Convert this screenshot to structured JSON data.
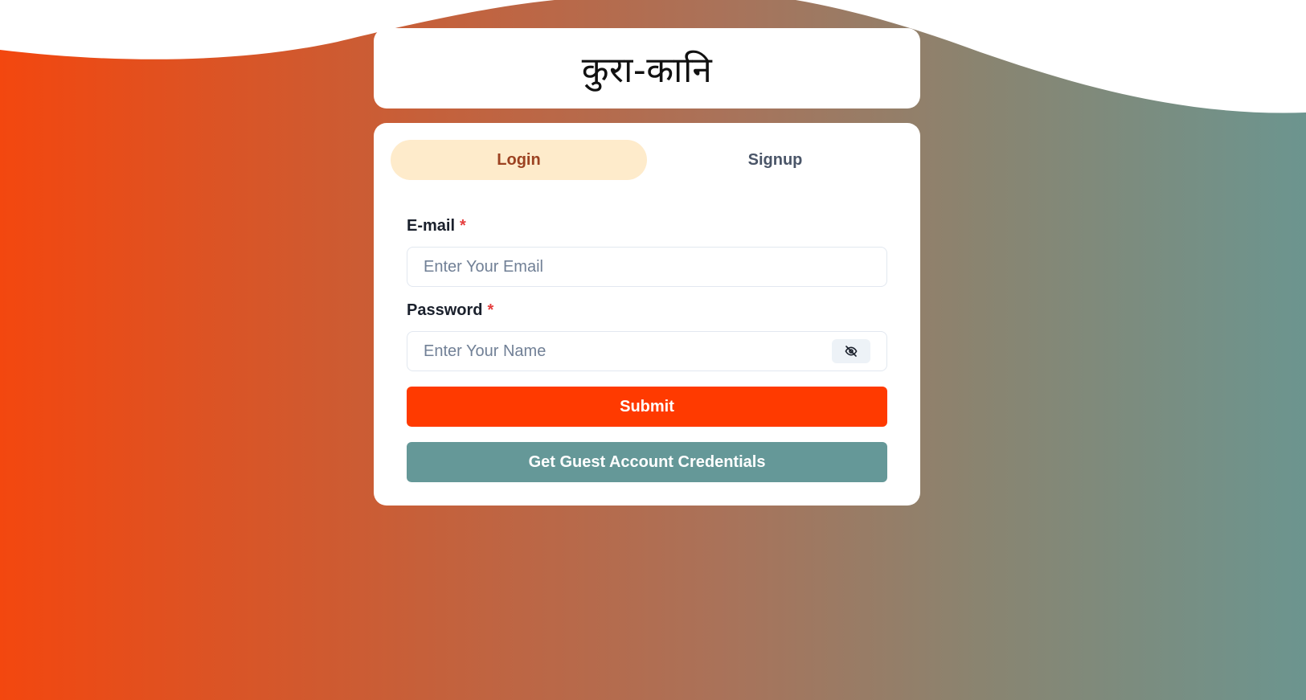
{
  "app": {
    "title": "कुरा-कानि"
  },
  "tabs": [
    {
      "label": "Login",
      "active": true
    },
    {
      "label": "Signup",
      "active": false
    }
  ],
  "form": {
    "email": {
      "label": "E-mail",
      "required_mark": "*",
      "placeholder": "Enter Your Email",
      "value": ""
    },
    "password": {
      "label": "Password",
      "required_mark": "*",
      "placeholder": "Enter Your Name",
      "value": "",
      "toggle_icon": "eye-off-icon"
    },
    "submit_label": "Submit",
    "guest_label": "Get Guest Account Credentials"
  },
  "colors": {
    "gradient_start": "#f3470f",
    "gradient_end": "#6c958f",
    "active_tab_bg": "#feebcb",
    "active_tab_text": "#9c4221",
    "submit_bg": "#ff3a00",
    "guest_bg": "#659898",
    "required": "#e53e3e"
  }
}
